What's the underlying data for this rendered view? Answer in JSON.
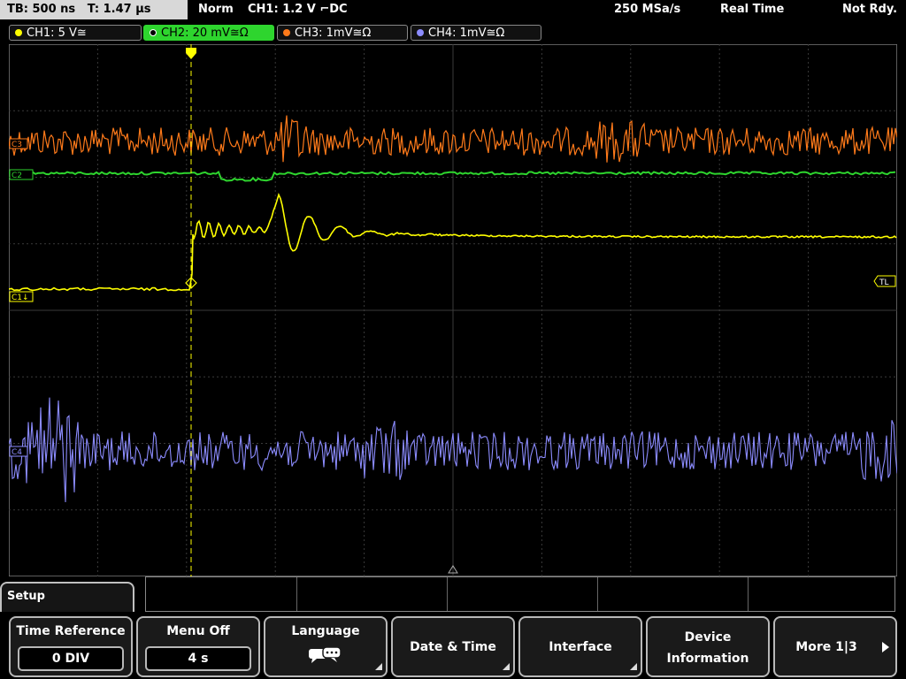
{
  "header": {
    "timebase": "TB: 500 ns",
    "trigger_time": "T: 1.47 µs",
    "mode": "Norm",
    "trigger_info": "CH1: 1.2 V ⌐DC",
    "sample_rate": "250 MSa/s",
    "acq_mode": "Real Time",
    "status": "Not Rdy."
  },
  "channels": [
    {
      "label": "CH1: 5 V≅",
      "color": "#ffff00"
    },
    {
      "label": "CH2: 20 mV≅Ω",
      "color": "#2ed52e"
    },
    {
      "label": "CH3: 1mV≅Ω",
      "color": "#ff7a1a"
    },
    {
      "label": "CH4: 1mV≅Ω",
      "color": "#8c8cff"
    }
  ],
  "markers": {
    "c1": "C1",
    "trigger_level": "TL",
    "ch2_marker": "C2",
    "ch3_marker": "C3",
    "ch4_marker": "C4"
  },
  "colors": {
    "ch1": "#ffff00",
    "ch2": "#2ed52e",
    "ch3": "#ff7a1a",
    "ch4": "#8c8cff",
    "grid": "#3a3a3a",
    "trigger": "#ffff00"
  },
  "menu": {
    "title": "Setup",
    "softkeys": [
      {
        "label": "Time Reference",
        "value": "0 DIV"
      },
      {
        "label": "Menu Off",
        "value": "4 s"
      },
      {
        "label": "Language",
        "icon": "speech-bubble-icon"
      },
      {
        "label": "Date & Time"
      },
      {
        "label": "Interface"
      },
      {
        "label": "Device",
        "label2": "Information"
      },
      {
        "label": "More 1|3"
      }
    ]
  }
}
